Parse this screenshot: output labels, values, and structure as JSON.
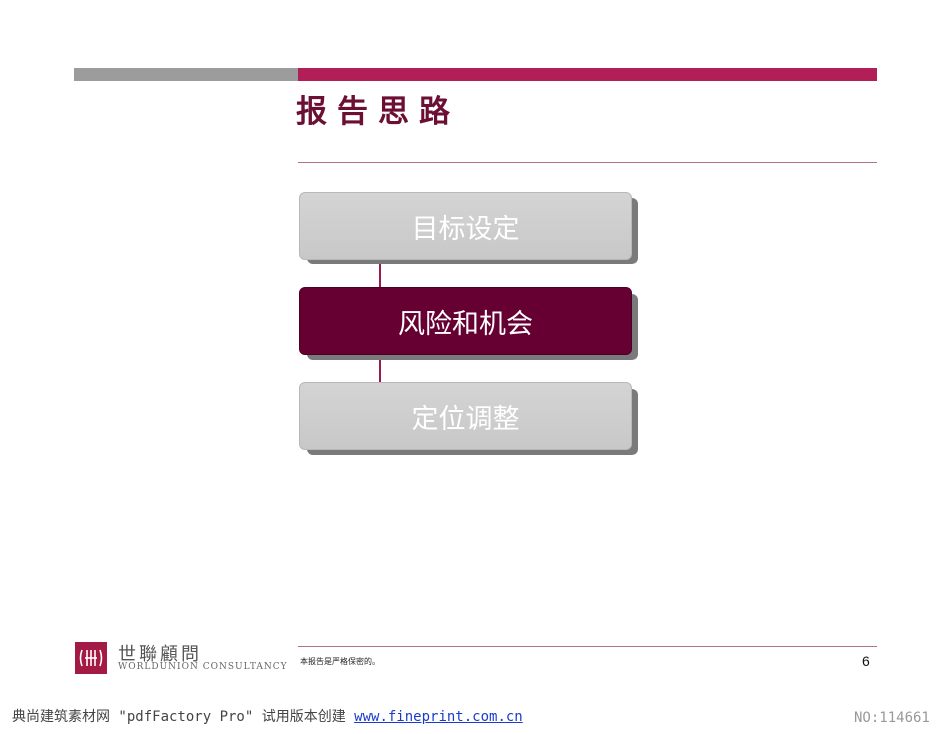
{
  "slide": {
    "title": "报告思路",
    "boxes": [
      {
        "label": "目标设定",
        "state": "inactive"
      },
      {
        "label": "风险和机会",
        "state": "active"
      },
      {
        "label": "定位调整",
        "state": "inactive"
      }
    ]
  },
  "footer": {
    "logo_cn": "世聯顧問",
    "logo_en": "WORLDUNION CONSULTANCY",
    "confidential": "本报告是严格保密的。",
    "page_number": "6"
  },
  "watermark": {
    "text": "典尚建筑素材网 \"pdfFactory Pro\" 试用版本创建 ",
    "link": "www.fineprint.com.cn",
    "id": "NO:114661"
  },
  "colors": {
    "accent": "#b11e58",
    "active_box": "#660033",
    "inactive_box": "#cccccc",
    "title": "#6b0f33"
  }
}
